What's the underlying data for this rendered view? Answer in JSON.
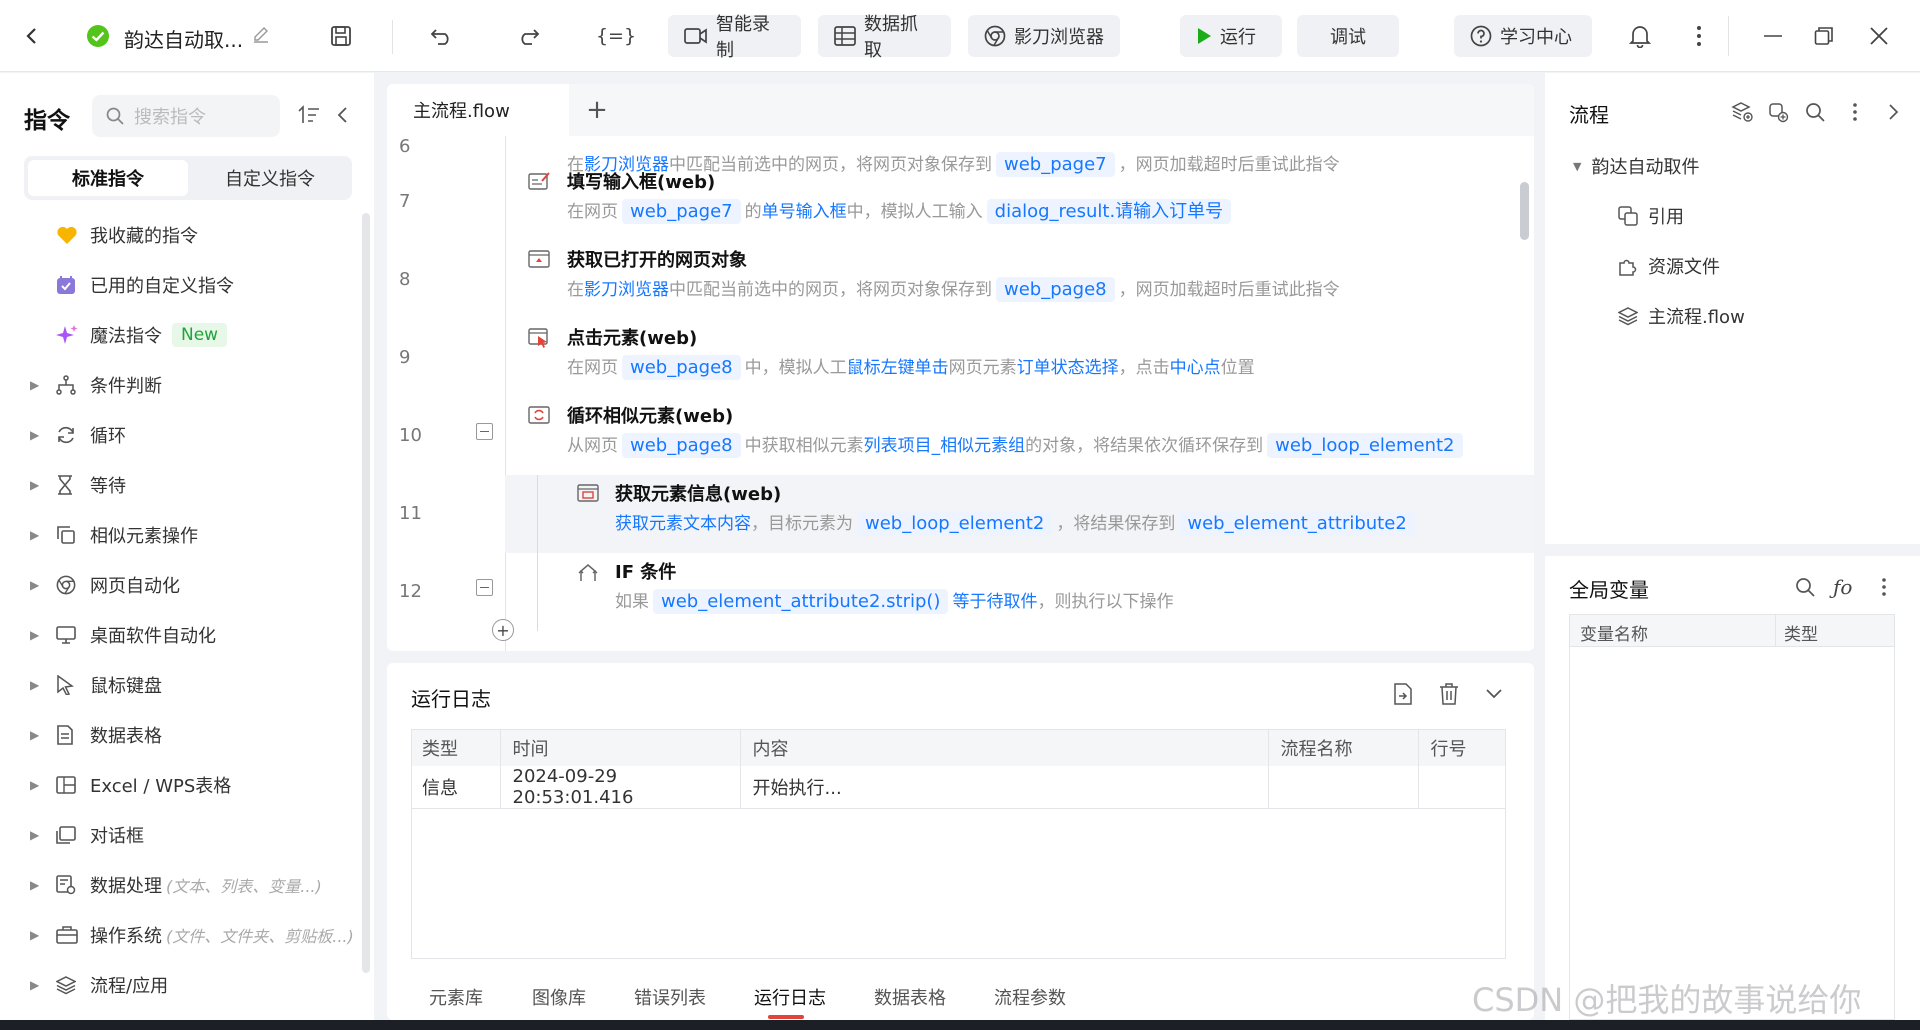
{
  "topbar": {
    "back_icon": "chevron-left-icon",
    "project_title": "韵达自动取...",
    "buttons": {
      "smart_record": "智能录制",
      "data_grab": "数据抓取",
      "browser": "影刀浏览器",
      "run": "运行",
      "debug": "调试",
      "learn": "学习中心"
    }
  },
  "left": {
    "title": "指令",
    "search_placeholder": "搜索指令",
    "tabs": {
      "standard": "标准指令",
      "custom": "自定义指令"
    },
    "favorites": "我收藏的指令",
    "used_custom": "已用的自定义指令",
    "magic": "魔法指令",
    "new_badge": "New",
    "categories": [
      {
        "label": "条件判断",
        "hint": ""
      },
      {
        "label": "循环",
        "hint": ""
      },
      {
        "label": "等待",
        "hint": ""
      },
      {
        "label": "相似元素操作",
        "hint": ""
      },
      {
        "label": "网页自动化",
        "hint": ""
      },
      {
        "label": "桌面软件自动化",
        "hint": ""
      },
      {
        "label": "鼠标键盘",
        "hint": ""
      },
      {
        "label": "数据表格",
        "hint": ""
      },
      {
        "label": "Excel / WPS表格",
        "hint": ""
      },
      {
        "label": "对话框",
        "hint": ""
      },
      {
        "label": "数据处理",
        "hint": "(文本、列表、变量...)"
      },
      {
        "label": "操作系统",
        "hint": "(文件、文件夹、剪贴板...)"
      },
      {
        "label": "流程/应用",
        "hint": ""
      }
    ]
  },
  "editor": {
    "tab": "主流程.flow",
    "add_tab": "+",
    "steps": [
      {
        "line": "6",
        "title": "",
        "desc": [
          {
            "t": "在",
            "c": ""
          },
          {
            "t": "影刀浏览器",
            "c": "kw"
          },
          {
            "t": "中匹配当前选中的网页，将网页对象保存到",
            "c": ""
          },
          {
            "t": "web_page7",
            "c": "var"
          },
          {
            "t": "，网页加载超时后重试此指令",
            "c": ""
          }
        ]
      },
      {
        "line": "7",
        "title": "填写输入框(web)",
        "desc": [
          {
            "t": "在网页",
            "c": ""
          },
          {
            "t": "web_page7",
            "c": "var"
          },
          {
            "t": "的",
            "c": ""
          },
          {
            "t": "单号输入框",
            "c": "kw"
          },
          {
            "t": "中，模拟人工输入",
            "c": ""
          },
          {
            "t": "dialog_result.请输入订单号",
            "c": "var"
          }
        ]
      },
      {
        "line": "8",
        "title": "获取已打开的网页对象",
        "desc": [
          {
            "t": "在",
            "c": ""
          },
          {
            "t": "影刀浏览器",
            "c": "kw"
          },
          {
            "t": "中匹配当前选中的网页，将网页对象保存到",
            "c": ""
          },
          {
            "t": "web_page8",
            "c": "var"
          },
          {
            "t": "，网页加载超时后重试此指令",
            "c": ""
          }
        ]
      },
      {
        "line": "9",
        "title": "点击元素(web)",
        "desc": [
          {
            "t": "在网页",
            "c": ""
          },
          {
            "t": "web_page8",
            "c": "var"
          },
          {
            "t": "中，模拟人工",
            "c": ""
          },
          {
            "t": "鼠标左键单击",
            "c": "kw"
          },
          {
            "t": "网页元素",
            "c": ""
          },
          {
            "t": "订单状态选择",
            "c": "kw"
          },
          {
            "t": "，点击",
            "c": ""
          },
          {
            "t": "中心点",
            "c": "kw"
          },
          {
            "t": "位置",
            "c": ""
          }
        ]
      },
      {
        "line": "10",
        "title": "循环相似元素(web)",
        "desc": [
          {
            "t": "从网页",
            "c": ""
          },
          {
            "t": "web_page8",
            "c": "var"
          },
          {
            "t": "中获取相似元素",
            "c": ""
          },
          {
            "t": "列表项目_相似元素组",
            "c": "kw"
          },
          {
            "t": "的对象，将结果依次循环保存到",
            "c": ""
          },
          {
            "t": "web_loop_element2",
            "c": "var"
          }
        ]
      },
      {
        "line": "11",
        "title": "获取元素信息(web)",
        "desc": [
          {
            "t": "获取元素文本内容",
            "c": "kw"
          },
          {
            "t": "，目标元素为",
            "c": ""
          },
          {
            "t": "web_loop_element2",
            "c": "var"
          },
          {
            "t": "，将结果保存到",
            "c": ""
          },
          {
            "t": "web_element_attribute2",
            "c": "var"
          }
        ]
      },
      {
        "line": "12",
        "title": "IF 条件",
        "desc": [
          {
            "t": "如果",
            "c": ""
          },
          {
            "t": "web_element_attribute2.strip()",
            "c": "var"
          },
          {
            "t": "等于",
            "c": "kw"
          },
          {
            "t": "待取件",
            "c": "kw"
          },
          {
            "t": "，则执行以下操作",
            "c": ""
          }
        ]
      }
    ]
  },
  "log": {
    "title": "运行日志",
    "columns": [
      "类型",
      "时间",
      "内容",
      "流程名称",
      "行号"
    ],
    "rows": [
      [
        "信息",
        "2024-09-29 20:53:01.416",
        "开始执行...",
        "",
        ""
      ]
    ],
    "bottom_tabs": [
      "元素库",
      "图像库",
      "错误列表",
      "运行日志",
      "数据表格",
      "流程参数"
    ],
    "active_tab": "运行日志"
  },
  "right": {
    "flow_title": "流程",
    "tree_root": "韵达自动取件",
    "tree_items": [
      "引用",
      "资源文件",
      "主流程.flow"
    ],
    "global_title": "全局变量",
    "var_columns": [
      "变量名称",
      "类型"
    ]
  },
  "watermark": "CSDN @把我的故事说给你",
  "colors": {
    "accent": "#1677ff",
    "run_green": "#1aad19",
    "success": "#52c41a",
    "fav": "#f7b500",
    "magic": "#a855f7",
    "badge_bg": "#e7f8e8",
    "badge_fg": "#22a33a"
  }
}
